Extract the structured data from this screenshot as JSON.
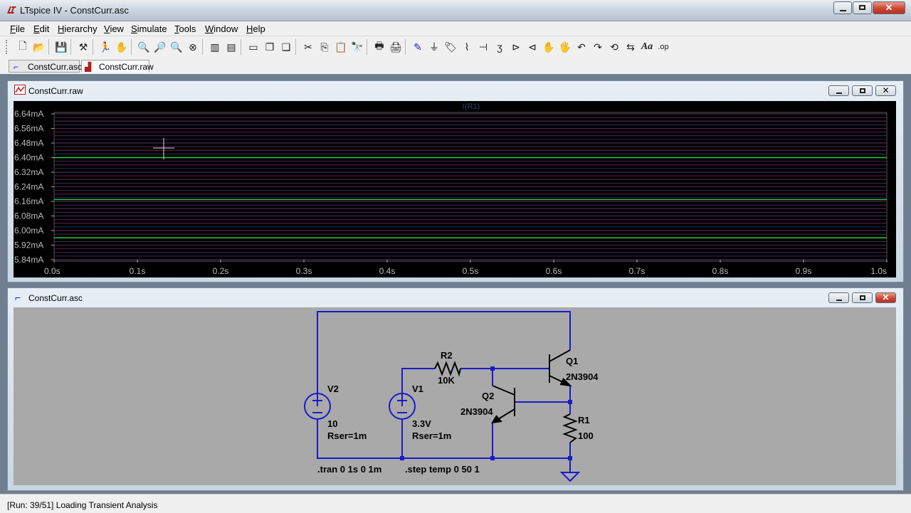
{
  "window": {
    "title": "LTspice IV - ConstCurr.asc"
  },
  "menu": [
    "File",
    "Edit",
    "Hierarchy",
    "View",
    "Simulate",
    "Tools",
    "Window",
    "Help"
  ],
  "tabs": [
    {
      "label": "ConstCurr.asc",
      "icon": "schematic-icon"
    },
    {
      "label": "ConstCurr.raw",
      "icon": "waveform-icon"
    }
  ],
  "waveform_window": {
    "title": "ConstCurr.raw",
    "trace_label": "I(R1)"
  },
  "schematic_window": {
    "title": "ConstCurr.asc"
  },
  "chart_data": {
    "type": "line",
    "title": "",
    "trace_label": "I(R1)",
    "x_ticks": [
      "0.0s",
      "0.1s",
      "0.2s",
      "0.3s",
      "0.4s",
      "0.5s",
      "0.6s",
      "0.7s",
      "0.8s",
      "0.9s",
      "1.0s"
    ],
    "y_ticks": [
      "6.64mA",
      "6.56mA",
      "6.48mA",
      "6.40mA",
      "6.32mA",
      "6.24mA",
      "6.16mA",
      "6.08mA",
      "6.00mA",
      "5.92mA",
      "5.84mA"
    ],
    "xlim": [
      0,
      1.0
    ],
    "ylim": [
      5.84,
      6.68
    ],
    "x_unit": "s",
    "y_unit": "mA",
    "series_levels_mA": [
      6.64,
      6.62,
      6.6,
      6.58,
      6.56,
      6.54,
      6.52,
      6.5,
      6.48,
      6.46,
      6.44,
      6.42,
      6.4,
      6.38,
      6.36,
      6.34,
      6.32,
      6.3,
      6.28,
      6.26,
      6.24,
      6.22,
      6.2,
      6.18,
      6.16,
      6.14,
      6.12,
      6.1,
      6.08,
      6.06,
      6.04,
      6.02,
      6.0,
      5.98,
      5.96,
      5.94,
      5.92,
      5.9,
      5.88,
      5.86,
      5.84
    ],
    "highlight_levels_mA": [
      6.4,
      6.17,
      5.96
    ],
    "grid": true
  },
  "schematic": {
    "labels": {
      "v2_name": "V2",
      "v2_value": "10",
      "v2_rser": "Rser=1m",
      "v1_name": "V1",
      "v1_value": "3.3V",
      "v1_rser": "Rser=1m",
      "r2_name": "R2",
      "r2_value": "10K",
      "q1_name": "Q1",
      "q1_model": "2N3904",
      "q2_name": "Q2",
      "q2_model": "2N3904",
      "r1_name": "R1",
      "r1_value": "100",
      "tran_directive": ".tran 0 1s 0 1m",
      "step_directive": ".step temp 0 50 1"
    }
  },
  "status": {
    "text": "[Run: 39/51] Loading Transient Analysis"
  },
  "colors": {
    "wire": "#1a1acc",
    "plot_bg": "#000000",
    "schematic_bg": "#a9a9a9",
    "trace_highlight": "#2ecc40"
  }
}
